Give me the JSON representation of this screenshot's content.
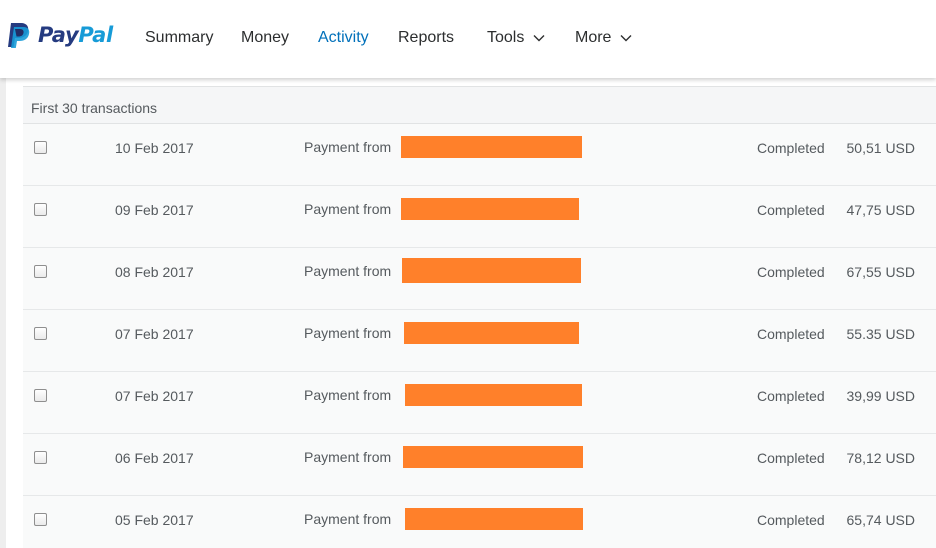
{
  "brand": {
    "name_a": "Pay",
    "name_b": "Pal",
    "primary_color": "#253b80",
    "secondary_color": "#179bd7"
  },
  "nav": {
    "summary": "Summary",
    "money": "Money",
    "activity": "Activity",
    "reports": "Reports",
    "tools": "Tools",
    "more": "More",
    "active_color": "#0070ba"
  },
  "panel": {
    "heading": "First 30 transactions"
  },
  "redaction_color": "#ff802a",
  "transactions": [
    {
      "date": "10 Feb 2017",
      "description": "Payment from",
      "status": "Completed",
      "amount": "50,51 USD"
    },
    {
      "date": "09 Feb 2017",
      "description": "Payment from",
      "status": "Completed",
      "amount": "47,75 USD"
    },
    {
      "date": "08 Feb 2017",
      "description": "Payment from",
      "status": "Completed",
      "amount": "67,55 USD"
    },
    {
      "date": "07 Feb 2017",
      "description": "Payment from",
      "status": "Completed",
      "amount": "55.35 USD"
    },
    {
      "date": "07 Feb 2017",
      "description": "Payment from",
      "status": "Completed",
      "amount": "39,99 USD"
    },
    {
      "date": "06 Feb 2017",
      "description": "Payment from",
      "status": "Completed",
      "amount": "78,12 USD"
    },
    {
      "date": "05 Feb 2017",
      "description": "Payment from",
      "status": "Completed",
      "amount": "65,74 USD"
    }
  ]
}
